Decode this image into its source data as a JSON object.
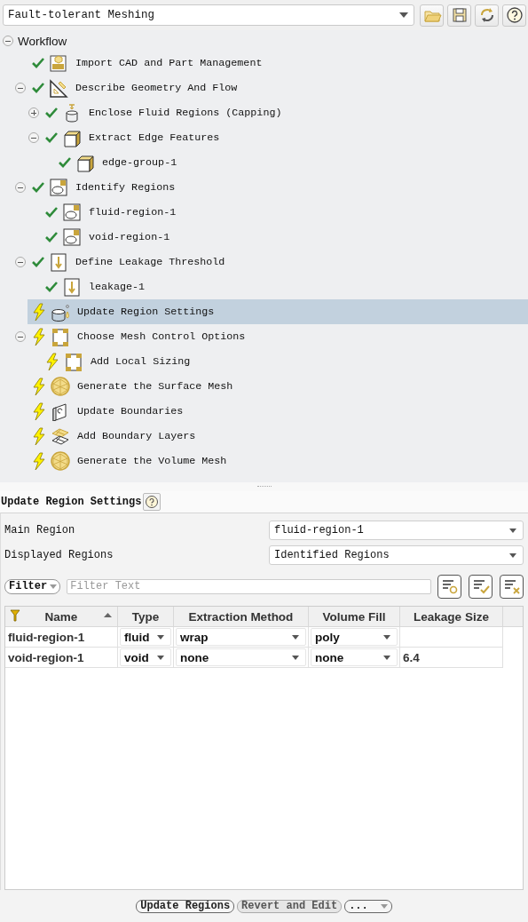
{
  "workflow_selector": {
    "value": "Fault-tolerant Meshing"
  },
  "toolbar_buttons": [
    {
      "kind": "open"
    },
    {
      "kind": "save"
    },
    {
      "kind": "refresh"
    },
    {
      "kind": "help"
    }
  ],
  "tree": {
    "label": "Workflow",
    "expanded": true,
    "children": [
      {
        "label": "Import CAD and Part Management",
        "complete": true,
        "kind": "cad",
        "selected": false
      },
      {
        "label": "Describe Geometry And Flow",
        "complete": true,
        "kind": "geometry",
        "expanded": true,
        "selected": false,
        "children": [
          {
            "label": "Enclose Fluid Regions (Capping)",
            "complete": true,
            "kind": "capping",
            "expanded": false,
            "selected": false
          },
          {
            "label": "Extract Edge Features",
            "complete": true,
            "kind": "box",
            "expanded": true,
            "selected": false,
            "children": [
              {
                "label": "edge-group-1",
                "complete": true,
                "kind": "box",
                "selected": false
              }
            ]
          }
        ]
      },
      {
        "label": "Identify Regions",
        "complete": true,
        "kind": "region",
        "expanded": true,
        "selected": false,
        "children": [
          {
            "label": "fluid-region-1",
            "complete": true,
            "kind": "region",
            "selected": false
          },
          {
            "label": "void-region-1",
            "complete": true,
            "kind": "region",
            "selected": false
          }
        ]
      },
      {
        "label": "Define Leakage Threshold",
        "complete": true,
        "kind": "leakage",
        "expanded": true,
        "selected": false,
        "children": [
          {
            "label": "leakage-1",
            "complete": true,
            "kind": "leakage",
            "selected": false
          }
        ]
      },
      {
        "label": "Update Region Settings",
        "complete": false,
        "kind": "update",
        "selected": true
      },
      {
        "label": "Choose Mesh Control Options",
        "complete": false,
        "kind": "control",
        "expanded": true,
        "selected": false,
        "children": [
          {
            "label": "Add Local Sizing",
            "complete": false,
            "kind": "control",
            "selected": false
          }
        ]
      },
      {
        "label": "Generate the Surface Mesh",
        "complete": false,
        "kind": "mesh",
        "selected": false
      },
      {
        "label": "Update Boundaries",
        "complete": false,
        "kind": "boundary",
        "selected": false
      },
      {
        "label": "Add Boundary Layers",
        "complete": false,
        "kind": "layers",
        "selected": false
      },
      {
        "label": "Generate the Volume Mesh",
        "complete": false,
        "kind": "mesh",
        "selected": false
      }
    ]
  },
  "panel": {
    "title": "Update Region Settings",
    "fields": [
      {
        "label": "Main Region",
        "value": "fluid-region-1"
      },
      {
        "label": "Displayed Regions",
        "value": "Identified Regions"
      }
    ],
    "filter": {
      "mode": "Filter",
      "placeholder": "Filter Text"
    },
    "filter_buttons": [
      {
        "kind": "add"
      },
      {
        "kind": "check"
      },
      {
        "kind": "clear"
      }
    ],
    "table": {
      "columns": [
        "Name",
        "Type",
        "Extraction Method",
        "Volume Fill",
        "Leakage Size"
      ],
      "rows": [
        {
          "name": "fluid-region-1",
          "type": "fluid",
          "extraction_method": "wrap",
          "volume_fill": "poly"
        },
        {
          "name": "void-region-1",
          "type": "void",
          "extraction_method": "none",
          "volume_fill": "none",
          "leakage_size": "6.4"
        }
      ]
    }
  },
  "buttons": [
    {
      "label": "Update Regions",
      "kind": "button",
      "disabled": false
    },
    {
      "label": "Revert and Edit",
      "kind": "button",
      "disabled": true
    },
    {
      "label": "...",
      "kind": "dropdown",
      "disabled": false
    }
  ]
}
